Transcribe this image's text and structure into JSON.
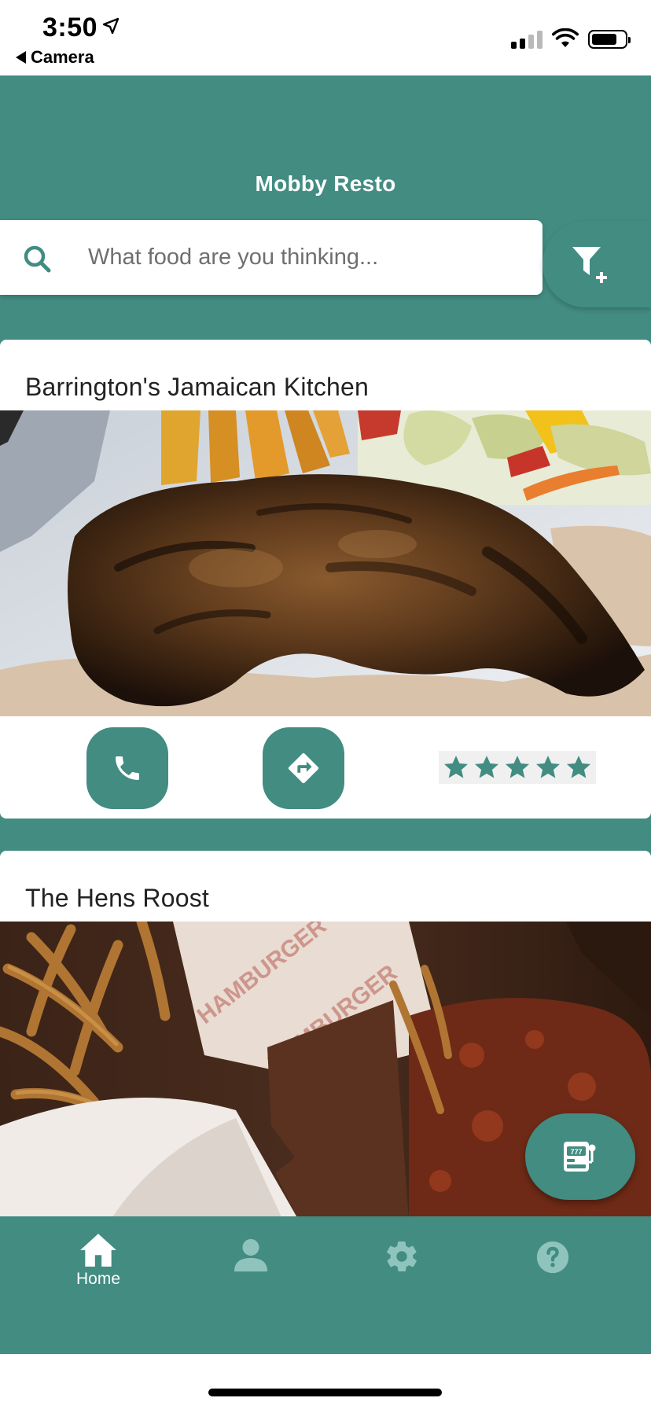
{
  "status_bar": {
    "time": "3:50",
    "back_label": "Camera"
  },
  "header": {
    "title": "Mobby Resto"
  },
  "search": {
    "placeholder": "What food are you thinking...",
    "value": ""
  },
  "restaurants": [
    {
      "name": "Barrington's Jamaican Kitchen",
      "rating": 5,
      "max_rating": 5
    },
    {
      "name": "The Hens Roost",
      "photo_text": "HAMBURGER"
    }
  ],
  "bottom_nav": {
    "items": [
      {
        "id": "home",
        "label": "Home",
        "icon": "home-icon",
        "active": true
      },
      {
        "id": "profile",
        "label": "",
        "icon": "person-icon",
        "active": false
      },
      {
        "id": "settings",
        "label": "",
        "icon": "gear-icon",
        "active": false
      },
      {
        "id": "help",
        "label": "",
        "icon": "help-icon",
        "active": false
      }
    ]
  },
  "colors": {
    "primary": "#428c82",
    "inactive_icon": "#8fc4bd",
    "white": "#ffffff"
  }
}
